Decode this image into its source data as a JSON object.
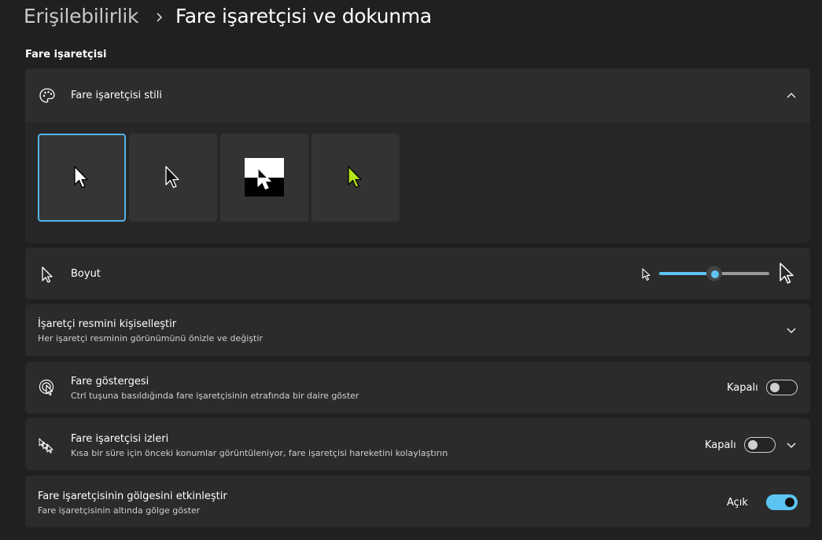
{
  "breadcrumb": {
    "parent": "Erişilebilirlik",
    "current": "Fare işaretçisi ve dokunma"
  },
  "section": {
    "title": "Fare işaretçisi"
  },
  "pointer_style": {
    "label": "Fare işaretçisi stili",
    "icon": "palette-icon",
    "expanded": true,
    "options": [
      {
        "name": "white",
        "selected": true
      },
      {
        "name": "black",
        "selected": false
      },
      {
        "name": "inverted",
        "selected": false
      },
      {
        "name": "custom",
        "selected": false,
        "color": "#b4e619"
      }
    ]
  },
  "size": {
    "label": "Boyut",
    "icon": "pointer-icon",
    "value_fraction": 0.5
  },
  "customize": {
    "label": "İşaretçi resmini kişiselleştir",
    "description": "Her işaretçi resminin görünümünü önizle ve değiştir"
  },
  "indicator": {
    "label": "Fare göstergesi",
    "description": "Ctrl tuşuna basıldığında fare işaretçisinin etrafında bir daire göster",
    "state_label": "Kapalı",
    "on": false,
    "icon": "pointer-indicator-icon"
  },
  "trails": {
    "label": "Fare işaretçisi izleri",
    "description": "Kısa bir süre için önceki konumlar görüntüleniyor, fare işaretçisi hareketini kolaylaştırın",
    "state_label": "Kapalı",
    "on": false,
    "icon": "pointer-trails-icon"
  },
  "shadow": {
    "label": "Fare işaretçisinin gölgesini etkinleştir",
    "description": "Fare işaretçisinin altında gölge göster",
    "state_label": "Açık",
    "on": true
  },
  "colors": {
    "accent": "#5cc4f2",
    "background": "#202020",
    "card": "#2b2b2b"
  }
}
